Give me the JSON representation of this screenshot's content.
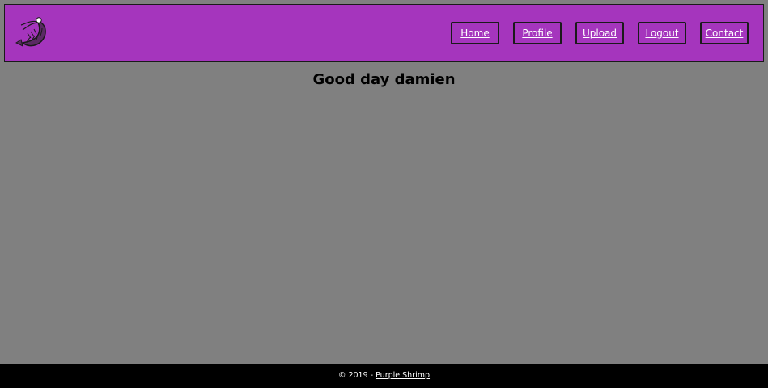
{
  "header": {
    "logo_icon": "shrimp-icon",
    "nav": {
      "home": "Home",
      "profile": "Profile",
      "upload": "Upload",
      "logout": "Logout",
      "contact": "Contact"
    }
  },
  "main": {
    "greeting": "Good day damien"
  },
  "footer": {
    "copyright": "© 2019 - ",
    "link_text": "Purple Shrimp"
  },
  "colors": {
    "background": "#808080",
    "header": "#a535bd",
    "footer": "#000000",
    "shrimp": "#5a2a63"
  }
}
